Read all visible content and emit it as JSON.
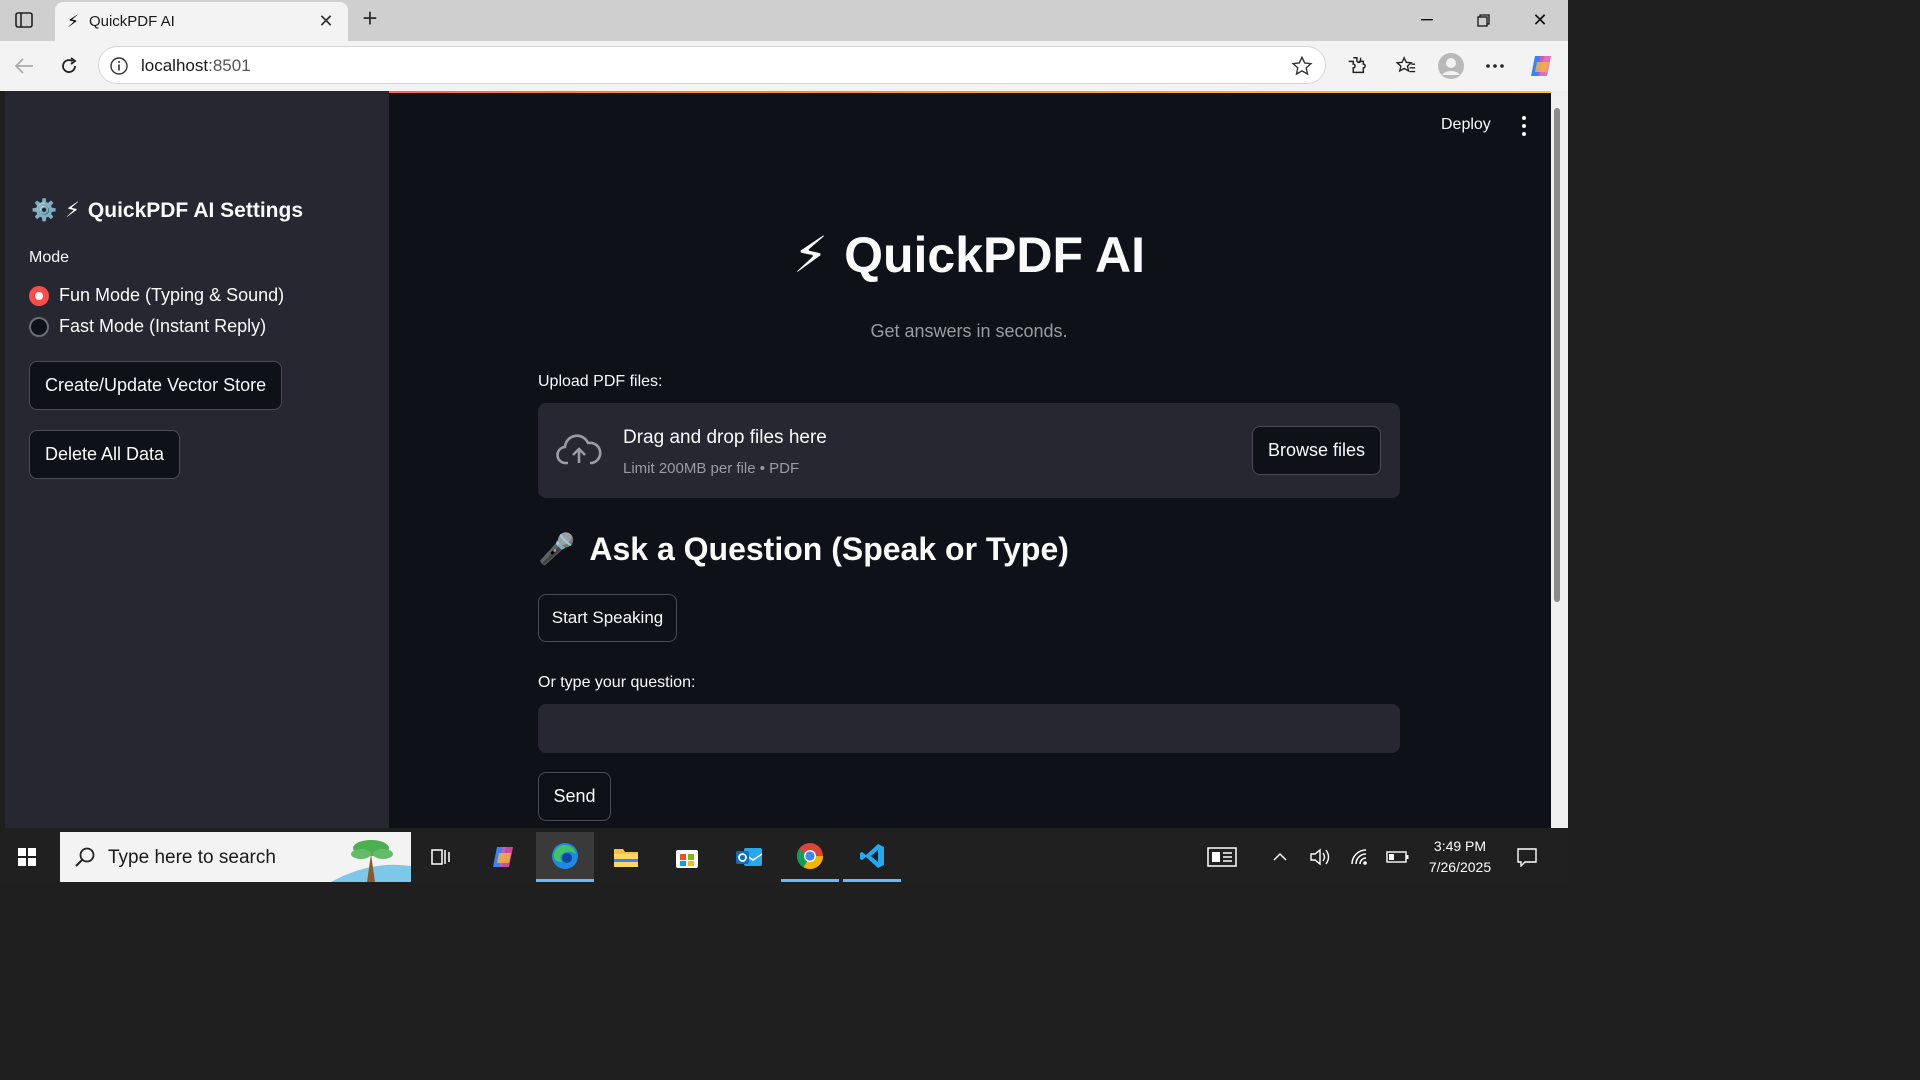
{
  "browser": {
    "tab_title": "QuickPDF AI",
    "url_host": "localhost",
    "url_port": ":8501"
  },
  "header": {
    "deploy_label": "Deploy"
  },
  "sidebar": {
    "title_icon": "⚙️",
    "title_emoji": "⚡",
    "title": "QuickPDF AI Settings",
    "mode_label": "Mode",
    "mode_options": [
      {
        "label": "Fun Mode (Typing & Sound)",
        "selected": true
      },
      {
        "label": "Fast Mode (Instant Reply)",
        "selected": false
      }
    ],
    "vector_store_button": "Create/Update Vector Store",
    "delete_button": "Delete All Data"
  },
  "main": {
    "title_emoji": "⚡",
    "title": "QuickPDF AI",
    "subtitle": "Get answers in seconds.",
    "upload_label": "Upload PDF files:",
    "dropzone_title": "Drag and drop files here",
    "dropzone_limit": "Limit 200MB per file • PDF",
    "browse_button": "Browse files",
    "ask_emoji": "🎤",
    "ask_heading": "Ask a Question (Speak or Type)",
    "speak_button": "Start Speaking",
    "question_label": "Or type your question:",
    "question_value": "",
    "send_button": "Send"
  },
  "taskbar": {
    "search_placeholder": "Type here to search",
    "time": "3:49 PM",
    "date": "7/26/2025"
  },
  "colors": {
    "accent": "#ff4b4b",
    "app_bg": "#0e1117",
    "sidebar_bg": "#262730"
  }
}
